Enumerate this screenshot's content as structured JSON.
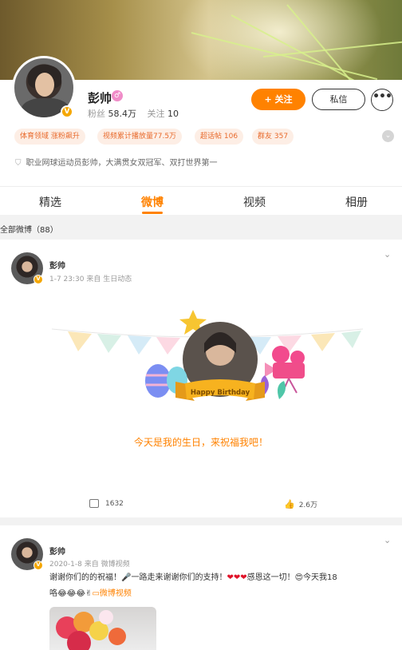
{
  "profile": {
    "name": "彭帅",
    "followers_label": "粉丝",
    "followers_value": "58.4万",
    "following_label": "关注",
    "following_value": "10",
    "follow_button": "+ 关注",
    "message_button": "私信",
    "more_button": "•••",
    "tags": [
      "体育领域 涨粉飙升",
      "视频累计播放量77.5万",
      "超话帖 106",
      "群友 357"
    ],
    "bio": "职业网球运动员彭帅，大满贯女双冠军、双打世界第一"
  },
  "tabs": [
    "精选",
    "微博",
    "视频",
    "相册"
  ],
  "active_tab": "微博",
  "section_label": "全部微博（88）",
  "post1": {
    "author": "彭帅",
    "time": "1-7 23:30",
    "source": "来自 生日动态",
    "banner_label": "Happy Birthday",
    "body": "今天是我的生日，来祝福我吧！",
    "comments": "1632",
    "likes": "2.6万"
  },
  "post2": {
    "author": "彭帅",
    "time": "2020-1-8",
    "source": "来自 微博视频",
    "text_part1": "谢谢你们的的祝福！",
    "text_part2": "一路走来谢谢你们的支持！",
    "text_part3": "感恩这一切！",
    "text_part4": "今天我18",
    "text_part5": "咯",
    "link": "微博视频"
  },
  "colors": {
    "accent": "#ff8200",
    "verified": "#f5a700",
    "tag_bg": "#fdeee5"
  }
}
